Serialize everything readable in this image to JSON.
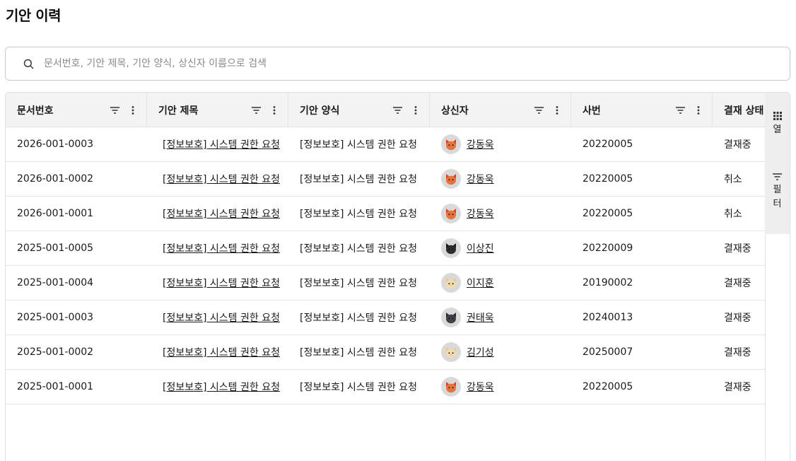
{
  "page": {
    "title": "기안 이력"
  },
  "search": {
    "placeholder": "문서번호, 기안 제목, 기안 양식, 상신자 이름으로 검색",
    "value": ""
  },
  "columns": [
    "문서번호",
    "기안 제목",
    "기안 양식",
    "상신자",
    "사번",
    "결재 상태"
  ],
  "rows": [
    {
      "doc_no": "2026-001-0003",
      "title": "[정보보호] 시스템 권한 요청",
      "form": "[정보보호] 시스템 권한 요청",
      "submitter": "강동욱",
      "avatar": "orange-cat",
      "emp_no": "20220005",
      "status": "결재중"
    },
    {
      "doc_no": "2026-001-0002",
      "title": "[정보보호] 시스템 권한 요청",
      "form": "[정보보호] 시스템 권한 요청",
      "submitter": "강동욱",
      "avatar": "orange-cat",
      "emp_no": "20220005",
      "status": "취소"
    },
    {
      "doc_no": "2026-001-0001",
      "title": "[정보보호] 시스템 권한 요청",
      "form": "[정보보호] 시스템 권한 요청",
      "submitter": "강동욱",
      "avatar": "orange-cat",
      "emp_no": "20220005",
      "status": "취소"
    },
    {
      "doc_no": "2025-001-0005",
      "title": "[정보보호] 시스템 권한 요청",
      "form": "[정보보호] 시스템 권한 요청",
      "submitter": "이상진",
      "avatar": "black-cat",
      "emp_no": "20220009",
      "status": "결재중"
    },
    {
      "doc_no": "2025-001-0004",
      "title": "[정보보호] 시스템 권한 요청",
      "form": "[정보보호] 시스템 권한 요청",
      "submitter": "이지훈",
      "avatar": "cream-cat",
      "emp_no": "20190002",
      "status": "결재중"
    },
    {
      "doc_no": "2025-001-0003",
      "title": "[정보보호] 시스템 권한 요청",
      "form": "[정보보호] 시스템 권한 요청",
      "submitter": "권태욱",
      "avatar": "gray-cat",
      "emp_no": "20240013",
      "status": "결재중"
    },
    {
      "doc_no": "2025-001-0002",
      "title": "[정보보호] 시스템 권한 요청",
      "form": "[정보보호] 시스템 권한 요청",
      "submitter": "김기성",
      "avatar": "cream-cat",
      "emp_no": "20250007",
      "status": "결재중"
    },
    {
      "doc_no": "2025-001-0001",
      "title": "[정보보호] 시스템 권한 요청",
      "form": "[정보보호] 시스템 권한 요청",
      "submitter": "강동욱",
      "avatar": "orange-cat",
      "emp_no": "20220005",
      "status": "결재중"
    }
  ],
  "side_panel": {
    "columns_label": "열",
    "filter_label_1": "필",
    "filter_label_2": "터"
  },
  "avatar_colors": {
    "orange-cat": {
      "face": "#e8743b",
      "ear": "#d4452e",
      "bg": "#d9d9d9"
    },
    "black-cat": {
      "face": "#2b2b2b",
      "ear": "#1a1a1a",
      "bg": "#d9d9d9"
    },
    "cream-cat": {
      "face": "#f2dcae",
      "ear": "#e9c98c",
      "bg": "#d9d9d9"
    },
    "gray-cat": {
      "face": "#3b3f48",
      "ear": "#2a2d33",
      "bg": "#d9d9d9"
    }
  }
}
